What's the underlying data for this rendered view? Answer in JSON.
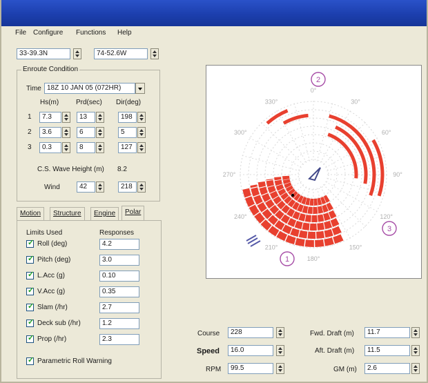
{
  "menu": [
    "File",
    "Configure",
    "Functions",
    "Help"
  ],
  "position": {
    "lat": "33-39.3N",
    "lon": "74-52.6W"
  },
  "enroute": {
    "title": "Enroute Condition",
    "time_label": "Time",
    "time_value": "18Z 10 JAN 05 (072HR)",
    "headers": [
      "Hs(m)",
      "Prd(sec)",
      "Dir(deg)"
    ],
    "rows": [
      {
        "num": "1",
        "hs": "7.3",
        "prd": "13",
        "dir": "198"
      },
      {
        "num": "2",
        "hs": "3.6",
        "prd": "6",
        "dir": "5"
      },
      {
        "num": "3",
        "hs": "0.3",
        "prd": "8",
        "dir": "127"
      }
    ],
    "cs_label": "C.S. Wave Height (m)",
    "cs_value": "8.2",
    "wind_label": "Wind",
    "wind_speed": "42",
    "wind_dir": "218"
  },
  "tabs": [
    "Motion",
    "Structure",
    "Engine",
    "Polar"
  ],
  "limits": {
    "col1": "Limits Used",
    "col2": "Responses",
    "items": [
      {
        "label": "Roll (deg)",
        "value": "4.2"
      },
      {
        "label": "Pitch (deg)",
        "value": "3.0"
      },
      {
        "label": "L.Acc (g)",
        "value": "0.10"
      },
      {
        "label": "V.Acc (g)",
        "value": "0.35"
      },
      {
        "label": "Slam (/hr)",
        "value": "2.7"
      },
      {
        "label": "Deck sub (/hr)",
        "value": "1.2"
      },
      {
        "label": "Prop (/hr)",
        "value": "2.3"
      }
    ],
    "warning": "Parametric Roll Warning"
  },
  "polar": {
    "angle_labels": [
      "0°",
      "30°",
      "60°",
      "90°",
      "120°",
      "150°",
      "180°",
      "210°",
      "240°",
      "270°",
      "300°",
      "330°"
    ],
    "markers": [
      "2",
      "3",
      "1"
    ],
    "zone_color": "#e8402f",
    "marker_color": "#a64ca6"
  },
  "controls": {
    "course_label": "Course",
    "course": "228",
    "speed_label": "Speed",
    "speed": "16.0",
    "rpm_label": "RPM",
    "rpm": "99.5",
    "fwd_label": "Fwd. Draft (m)",
    "fwd": "11.7",
    "aft_label": "Aft. Draft (m)",
    "aft": "11.5",
    "gm_label": "GM (m)",
    "gm": "2.6"
  }
}
